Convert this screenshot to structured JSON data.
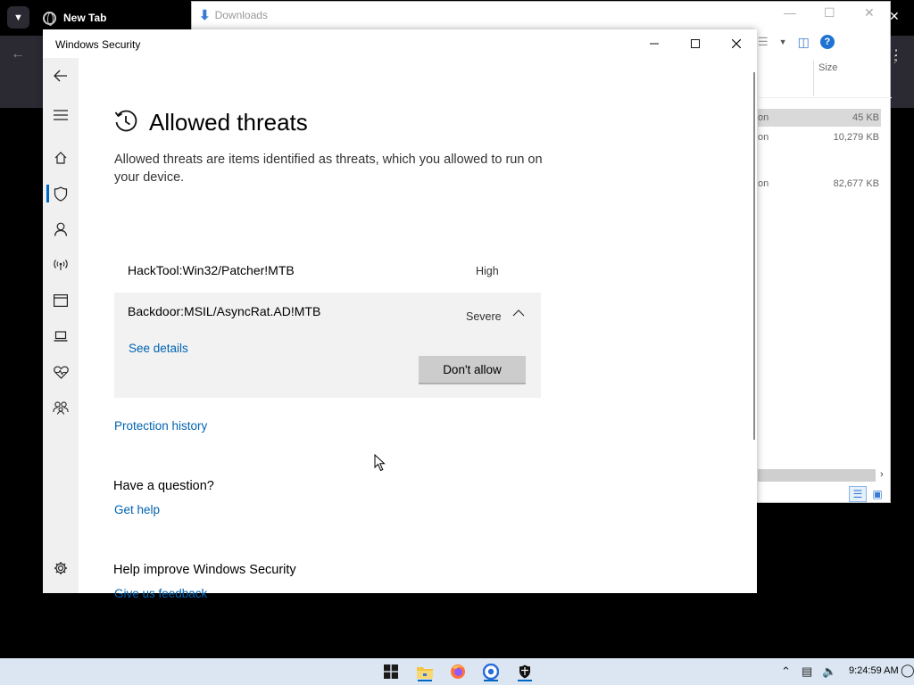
{
  "browser": {
    "tab_title": "New Tab"
  },
  "explorer": {
    "title": "Downloads",
    "size_header": "Size",
    "files": [
      {
        "name_partial": "on",
        "size": "45 KB",
        "selected": true
      },
      {
        "name_partial": "on",
        "size": "10,279 KB",
        "selected": false
      },
      {
        "name_partial": "on",
        "size": "82,677 KB",
        "selected": false
      }
    ]
  },
  "window": {
    "title": "Windows Security"
  },
  "page": {
    "title": "Allowed threats",
    "description": "Allowed threats are items identified as threats, which you allowed to run on your device."
  },
  "threats": [
    {
      "name": "HackTool:Win32/Patcher!MTB",
      "severity": "High"
    },
    {
      "name": "Backdoor:MSIL/AsyncRat.AD!MTB",
      "severity": "Severe",
      "expanded": true,
      "details_link": "See details",
      "action": "Don't allow"
    }
  ],
  "links": {
    "protection_history": "Protection history",
    "question_heading": "Have a question?",
    "get_help": "Get help",
    "improve_heading": "Help improve Windows Security",
    "feedback": "Give us feedback"
  },
  "sidebar_icons": [
    "back-icon",
    "menu-icon",
    "home-icon",
    "shield-icon",
    "account-icon",
    "network-icon",
    "app-browser-icon",
    "device-icon",
    "health-icon",
    "family-icon",
    "settings-icon"
  ],
  "sidebar_active": "shield-icon",
  "taskbar": {
    "time": "9:24:59 AM",
    "apps": [
      "start-icon",
      "file-explorer-icon",
      "firefox-icon",
      "chrome-icon",
      "windows-security-icon"
    ]
  },
  "colors": {
    "accent": "#0067c0",
    "link": "#0063b1",
    "sidebar_bg": "#f0f0f0",
    "expanded_bg": "#f2f2f2",
    "taskbar_bg": "#dbe6f2"
  }
}
